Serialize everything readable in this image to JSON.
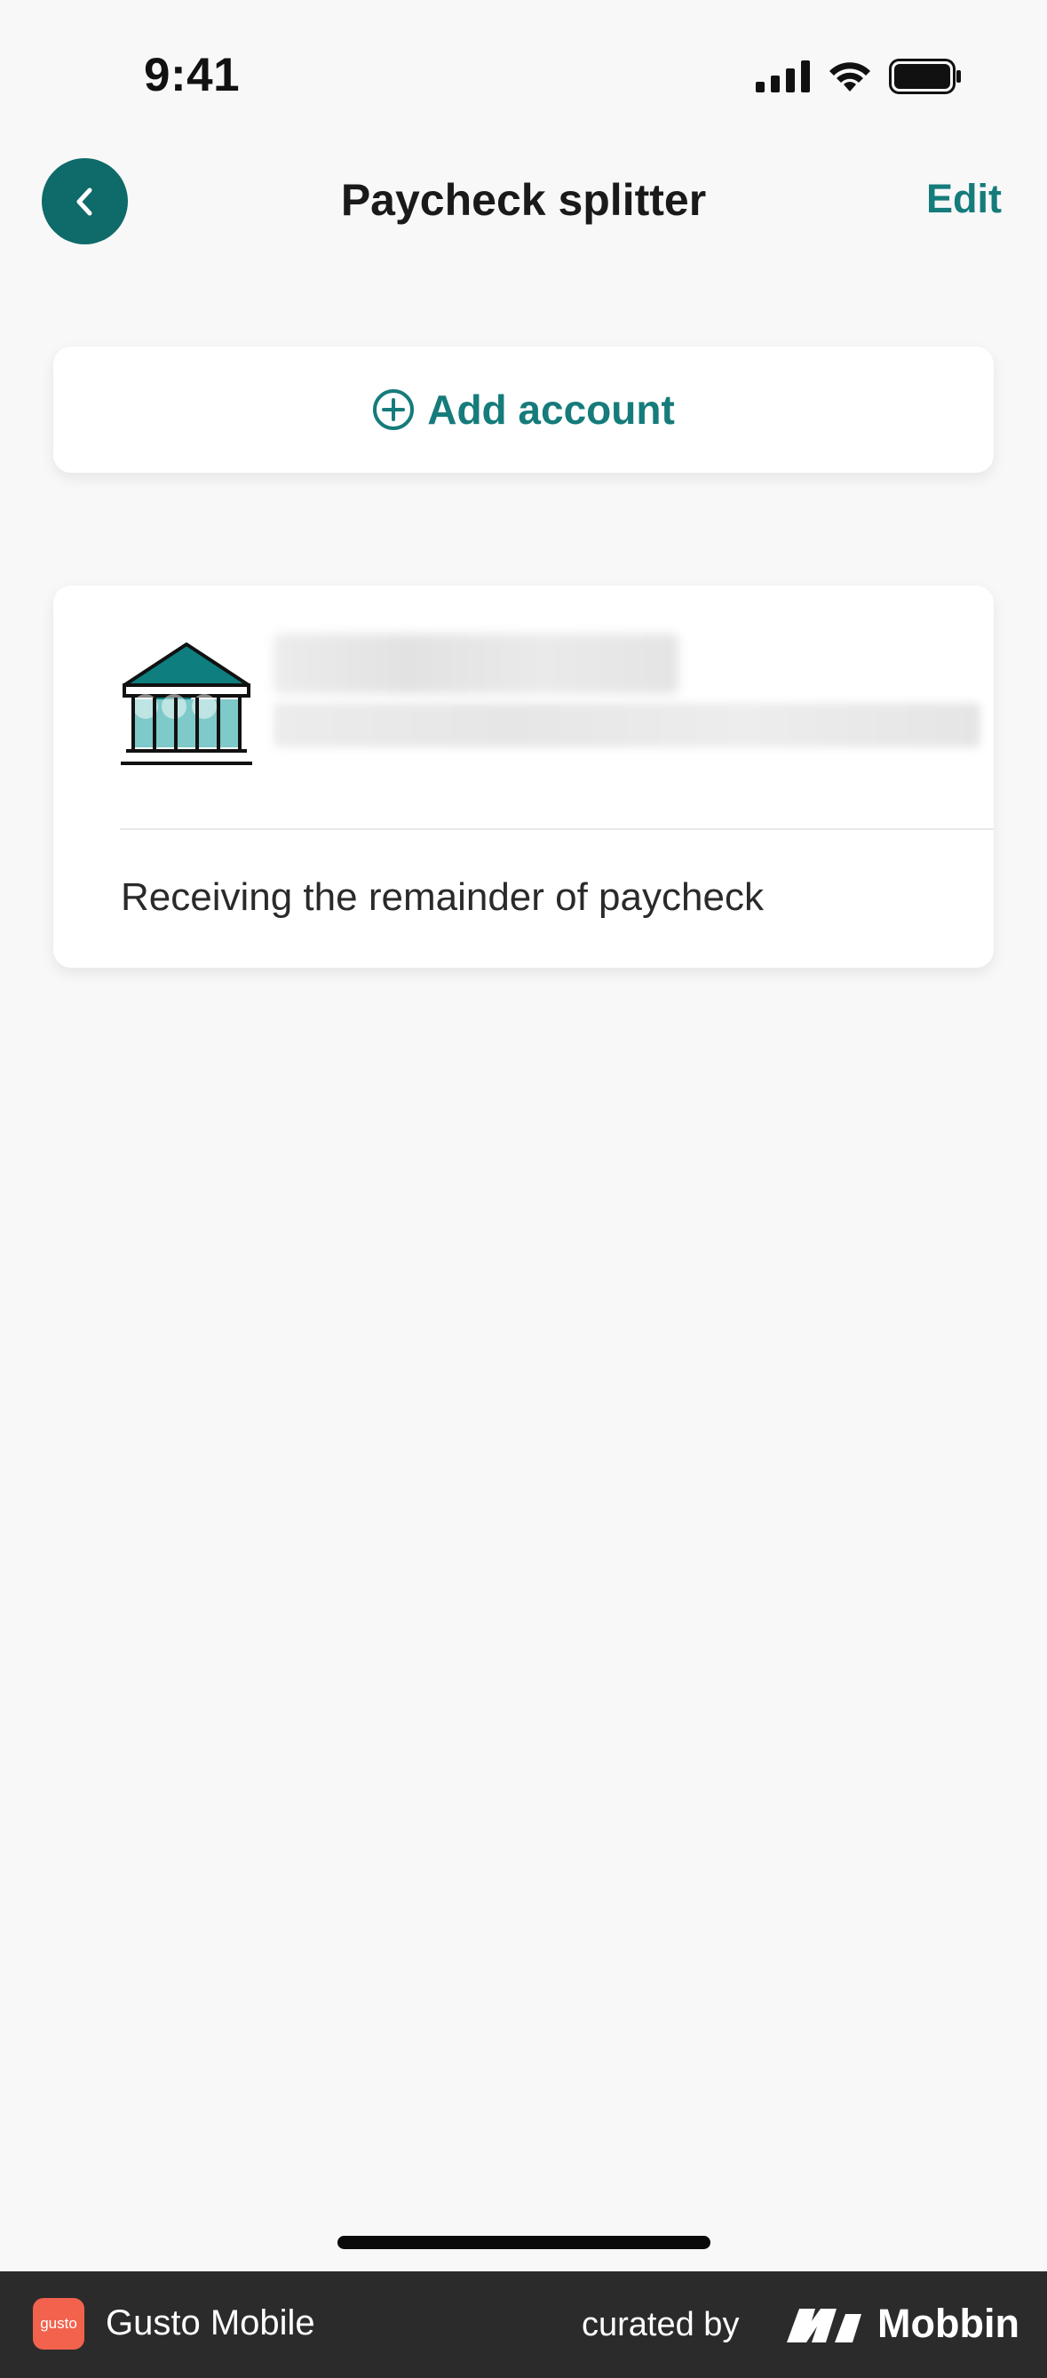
{
  "status_bar": {
    "time": "9:41"
  },
  "header": {
    "title": "Paycheck splitter",
    "edit_label": "Edit",
    "back_icon": "chevron-left-icon"
  },
  "add_account": {
    "label": "Add account",
    "icon": "plus-circle-icon"
  },
  "accounts": [
    {
      "icon": "bank-icon",
      "status": "Receiving the remainder of paycheck"
    }
  ],
  "footer": {
    "app_logo_text": "gusto",
    "app_name": "Gusto Mobile",
    "curated_by": "curated by",
    "brand": "Mobbin"
  },
  "colors": {
    "accent": "#167b7b",
    "back_button": "#0f6a6a",
    "background": "#f8f8f8",
    "footer": "#2b2b2b",
    "logo": "#f2624d"
  }
}
